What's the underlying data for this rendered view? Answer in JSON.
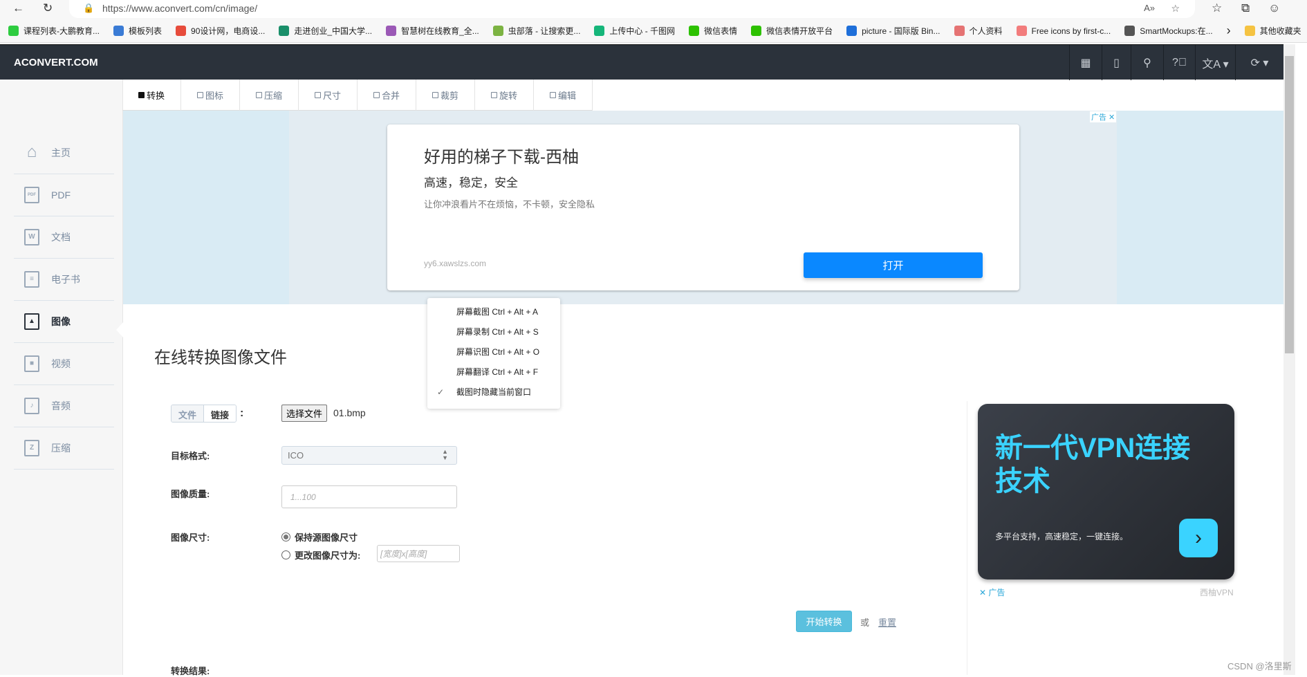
{
  "browser": {
    "url": "https://www.aconvert.com/cn/image/",
    "bookmarks": [
      {
        "label": "课程列表-大鹏教育...",
        "color": "#2ecc40"
      },
      {
        "label": "模板列表",
        "color": "#3a7bd5"
      },
      {
        "label": "90设计网，电商设...",
        "color": "#e74c3c"
      },
      {
        "label": "走进创业_中国大学...",
        "color": "#1a8f6a"
      },
      {
        "label": "智慧树在线教育_全...",
        "color": "#9b59b6"
      },
      {
        "label": "虫部落 - 让搜索更...",
        "color": "#7cb342"
      },
      {
        "label": "上传中心 - 千图网",
        "color": "#16b67a"
      },
      {
        "label": "微信表情",
        "color": "#2dc100"
      },
      {
        "label": "微信表情开放平台",
        "color": "#2dc100"
      },
      {
        "label": "picture - 国际版 Bin...",
        "color": "#1e6fd9"
      },
      {
        "label": "个人资料",
        "color": "#e57373"
      },
      {
        "label": "Free icons by first-c...",
        "color": "#f27c7c"
      },
      {
        "label": "SmartMockups:在...",
        "color": "#555555"
      }
    ],
    "other_bookmarks": "其他收藏夹"
  },
  "site": {
    "logo": "ACONVERT.COM",
    "tabs": [
      "转换",
      "图标",
      "压缩",
      "尺寸",
      "合并",
      "裁剪",
      "旋转",
      "编辑"
    ],
    "sidebar": [
      "主页",
      "PDF",
      "文档",
      "电子书",
      "图像",
      "视频",
      "音频",
      "压缩"
    ],
    "sidebar_icons": [
      "home-icon",
      "pdf-icon",
      "word-icon",
      "ebook-icon",
      "image-icon",
      "video-icon",
      "audio-icon",
      "zip-icon"
    ]
  },
  "ad": {
    "title": "好用的梯子下载-西柚",
    "subtitle": "高速，稳定，安全",
    "desc": "让你冲浪看片不在烦恼，不卡顿，安全隐私",
    "url": "yy6.xawslzs.com",
    "button": "打开",
    "tag": "广告 ✕"
  },
  "context_menu": [
    "屏幕截图 Ctrl + Alt + A",
    "屏幕录制 Ctrl + Alt + S",
    "屏幕识图 Ctrl + Alt + O",
    "屏幕翻译 Ctrl + Alt + F",
    "截图时隐藏当前窗口"
  ],
  "form": {
    "title": "在线转换图像文件",
    "src_file": "文件",
    "src_link": "链接",
    "colon": ":",
    "file_button": "选择文件",
    "file_name": "01.bmp",
    "format_label": "目标格式:",
    "format_value": "ICO",
    "quality_label": "图像质量:",
    "quality_placeholder": "1...100",
    "size_label": "图像尺寸:",
    "size_keep": "保持源图像尺寸",
    "size_change": "更改图像尺寸为:",
    "size_placeholder": "[宽度]x[高度]",
    "convert": "开始转换",
    "or": "或",
    "reset": "重置",
    "result_label": "转换结果:"
  },
  "vpn_ad": {
    "title": "新一代VPN连接技术",
    "subtitle": "多平台支持，高速稳定，一键连接。",
    "close": "✕ 广告",
    "brand": "西柚VPN"
  },
  "watermark": "CSDN @洛里斯"
}
